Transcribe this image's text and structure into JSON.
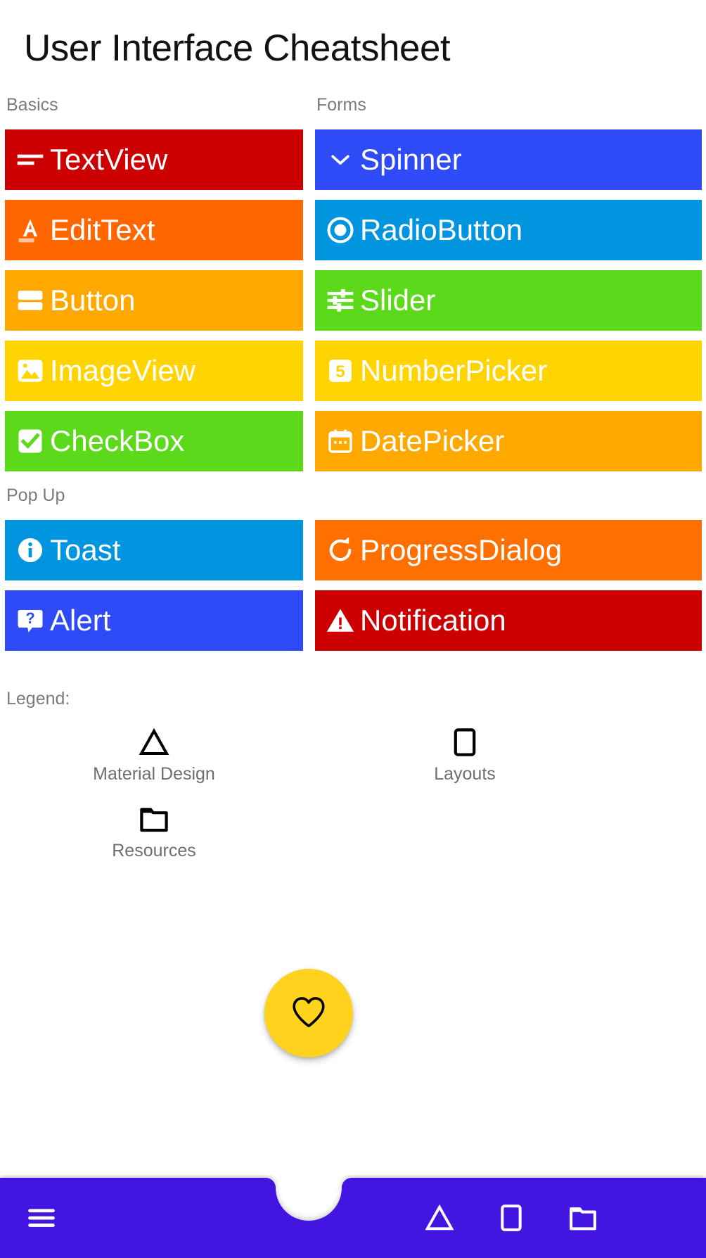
{
  "app": {
    "title": "User Interface Cheatsheet"
  },
  "sections": {
    "basics": {
      "label": "Basics"
    },
    "forms": {
      "label": "Forms"
    },
    "popup": {
      "label": "Pop Up"
    }
  },
  "colors": {
    "red": "#CC0000",
    "orange_red": "#FF6600",
    "amber": "#FFA800",
    "yellow": "#FFD400",
    "green": "#5CD91A",
    "blue": "#2F4BF7",
    "light_blue": "#0195E0",
    "orange": "#FF7000",
    "nav_purple": "#4318E0",
    "fab_yellow": "#FFD21E",
    "white": "#FFFFFF",
    "muted_text": "#7B7B7B"
  },
  "basics_items": [
    {
      "label": "TextView",
      "icon": "text-lines-icon",
      "color": "#CC0000"
    },
    {
      "label": "EditText",
      "icon": "edit-text-a-icon",
      "color": "#FF6600"
    },
    {
      "label": "Button",
      "icon": "button-stack-icon",
      "color": "#FFA800"
    },
    {
      "label": "ImageView",
      "icon": "image-icon",
      "color": "#FFD400"
    },
    {
      "label": "CheckBox",
      "icon": "checkbox-checked-icon",
      "color": "#5CD91A"
    }
  ],
  "forms_items": [
    {
      "label": "Spinner",
      "icon": "chevron-down-icon",
      "color": "#2F4BF7"
    },
    {
      "label": "RadioButton",
      "icon": "radio-button-icon",
      "color": "#0195E0"
    },
    {
      "label": "Slider",
      "icon": "sliders-icon",
      "color": "#5CD91A"
    },
    {
      "label": "NumberPicker",
      "icon": "number-five-icon",
      "color": "#FFD400"
    },
    {
      "label": "DatePicker",
      "icon": "calendar-icon",
      "color": "#FFA800"
    }
  ],
  "popup_items_left": [
    {
      "label": "Toast",
      "icon": "info-circle-icon",
      "color": "#0195E0"
    },
    {
      "label": "Alert",
      "icon": "question-bubble-icon",
      "color": "#2F4BF7"
    }
  ],
  "popup_items_right": [
    {
      "label": "ProgressDialog",
      "icon": "refresh-icon",
      "color": "#FF7000"
    },
    {
      "label": "Notification",
      "icon": "warning-triangle-icon",
      "color": "#CC0000"
    }
  ],
  "legend": {
    "label": "Legend:",
    "items": [
      {
        "label": "Material Design",
        "icon": "triangle-icon"
      },
      {
        "label": "Layouts",
        "icon": "square-icon"
      },
      {
        "label": "Resources",
        "icon": "folder-icon"
      }
    ]
  },
  "bottom_nav": {
    "menu": {
      "label": "Menu",
      "icon": "hamburger-menu-icon"
    },
    "items": [
      {
        "label": "Material Design",
        "icon": "triangle-icon"
      },
      {
        "label": "Layouts",
        "icon": "square-icon"
      },
      {
        "label": "Resources",
        "icon": "folder-icon"
      }
    ],
    "fab": {
      "label": "Favorite",
      "icon": "heart-icon"
    }
  }
}
